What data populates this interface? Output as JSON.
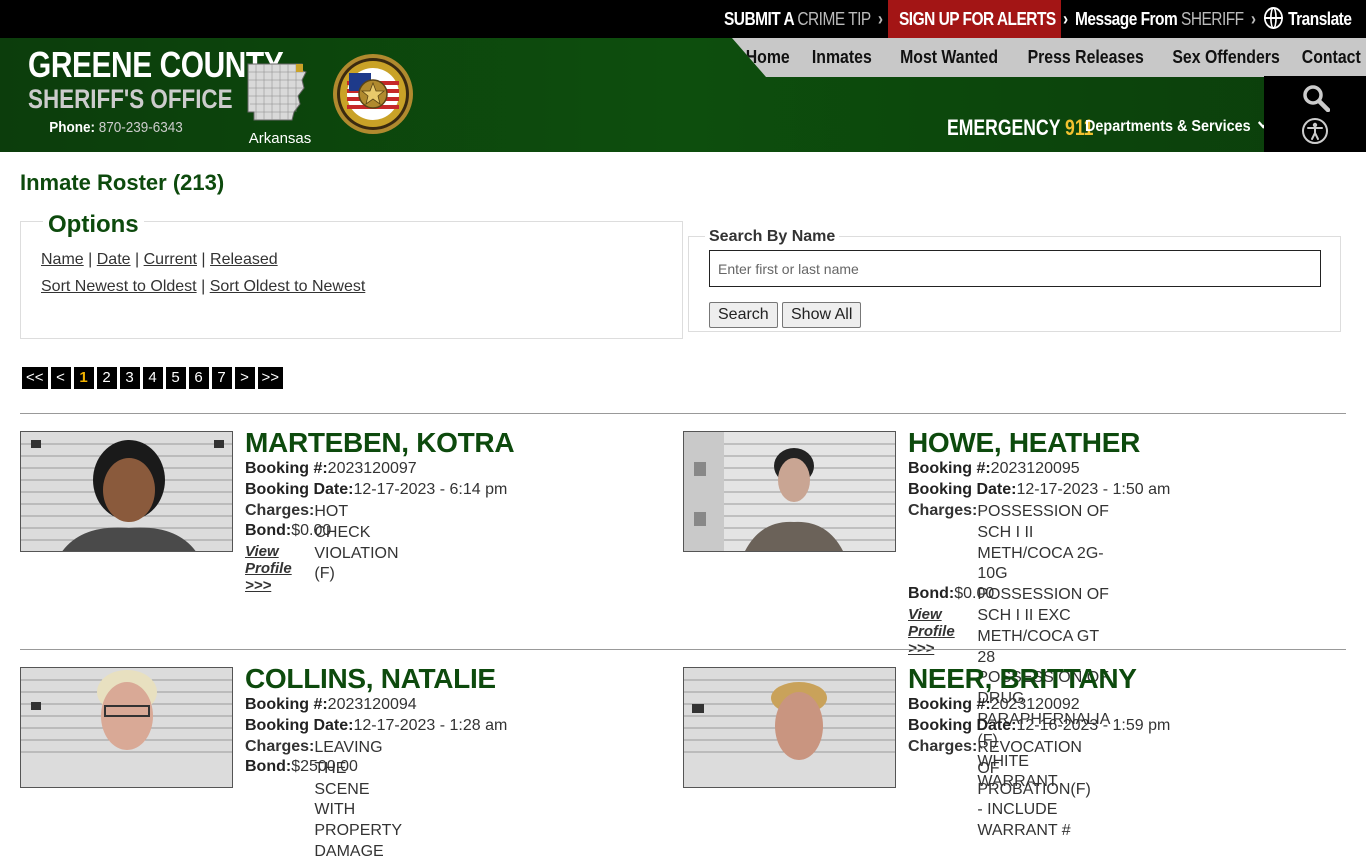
{
  "topbar": {
    "tip_a": "SUBMIT A",
    "tip_b": "CRIME TIP",
    "alerts": "SIGN UP FOR ALERTS",
    "msg_a": "Message From",
    "msg_b": "SHERIFF",
    "translate": "Translate",
    "chevron": "›"
  },
  "brand": {
    "county": "GREENE COUNTY",
    "office": "SHERIFF'S OFFICE",
    "phone_label": "Phone:",
    "phone": "870-239-6343",
    "state": "Arkansas"
  },
  "nav": [
    "Home",
    "Inmates",
    "Most Wanted",
    "Press Releases",
    "Sex Offenders",
    "Contact"
  ],
  "emergency": {
    "label": "EMERGENCY",
    "number": "911"
  },
  "departments": "Departments & Services",
  "page": {
    "title": "Inmate Roster (213)",
    "options_legend": "Options",
    "sort_links": [
      "Name",
      "Date",
      "Current",
      "Released"
    ],
    "order_links": [
      "Sort Newest to Oldest",
      "Sort Oldest to Newest"
    ],
    "separator": "|"
  },
  "search": {
    "label": "Search By Name",
    "placeholder": "Enter first or last name",
    "search_btn": "Search",
    "showall_btn": "Show All"
  },
  "pager": {
    "items": [
      "<<",
      "<",
      "1",
      "2",
      "3",
      "4",
      "5",
      "6",
      "7",
      ">",
      ">>"
    ],
    "current_page": "1"
  },
  "labels": {
    "booking_no": "Booking #:",
    "booking_date": "Booking Date:",
    "charges": "Charges:",
    "bond": "Bond:",
    "view_profile": "View Profile >>>"
  },
  "inmates": [
    {
      "name": "MARTEBEN, KOTRA",
      "booking_no": "2023120097",
      "booking_date": "12-17-2023 - 6:14 pm",
      "charges": [
        "HOT CHECK VIOLATION (F)"
      ],
      "bond": "$0.00"
    },
    {
      "name": "HOWE, HEATHER",
      "booking_no": "2023120095",
      "booking_date": "12-17-2023 - 1:50 am",
      "charges": [
        "POSSESSION OF SCH I II METH/COCA 2G-10G",
        "POSSESSION OF SCH I II EXC METH/COCA GT 28",
        "POSSESSION OF DRUG PARAPHERNALIA (F)",
        "WHITE WARRANT"
      ],
      "bond": "$0.00"
    },
    {
      "name": "COLLINS, NATALIE",
      "booking_no": "2023120094",
      "booking_date": "12-17-2023 - 1:28 am",
      "charges": [
        "LEAVING THE SCENE WITH PROPERTY DAMAGE"
      ],
      "bond": "$2500.00"
    },
    {
      "name": "NEER, BRITTANY",
      "booking_no": "2023120092",
      "booking_date": "12-16-2023 - 1:59 pm",
      "charges": [
        "REVOCATION OF PROBATION(F) - INCLUDE",
        "WARRANT #"
      ],
      "bond": ""
    }
  ]
}
